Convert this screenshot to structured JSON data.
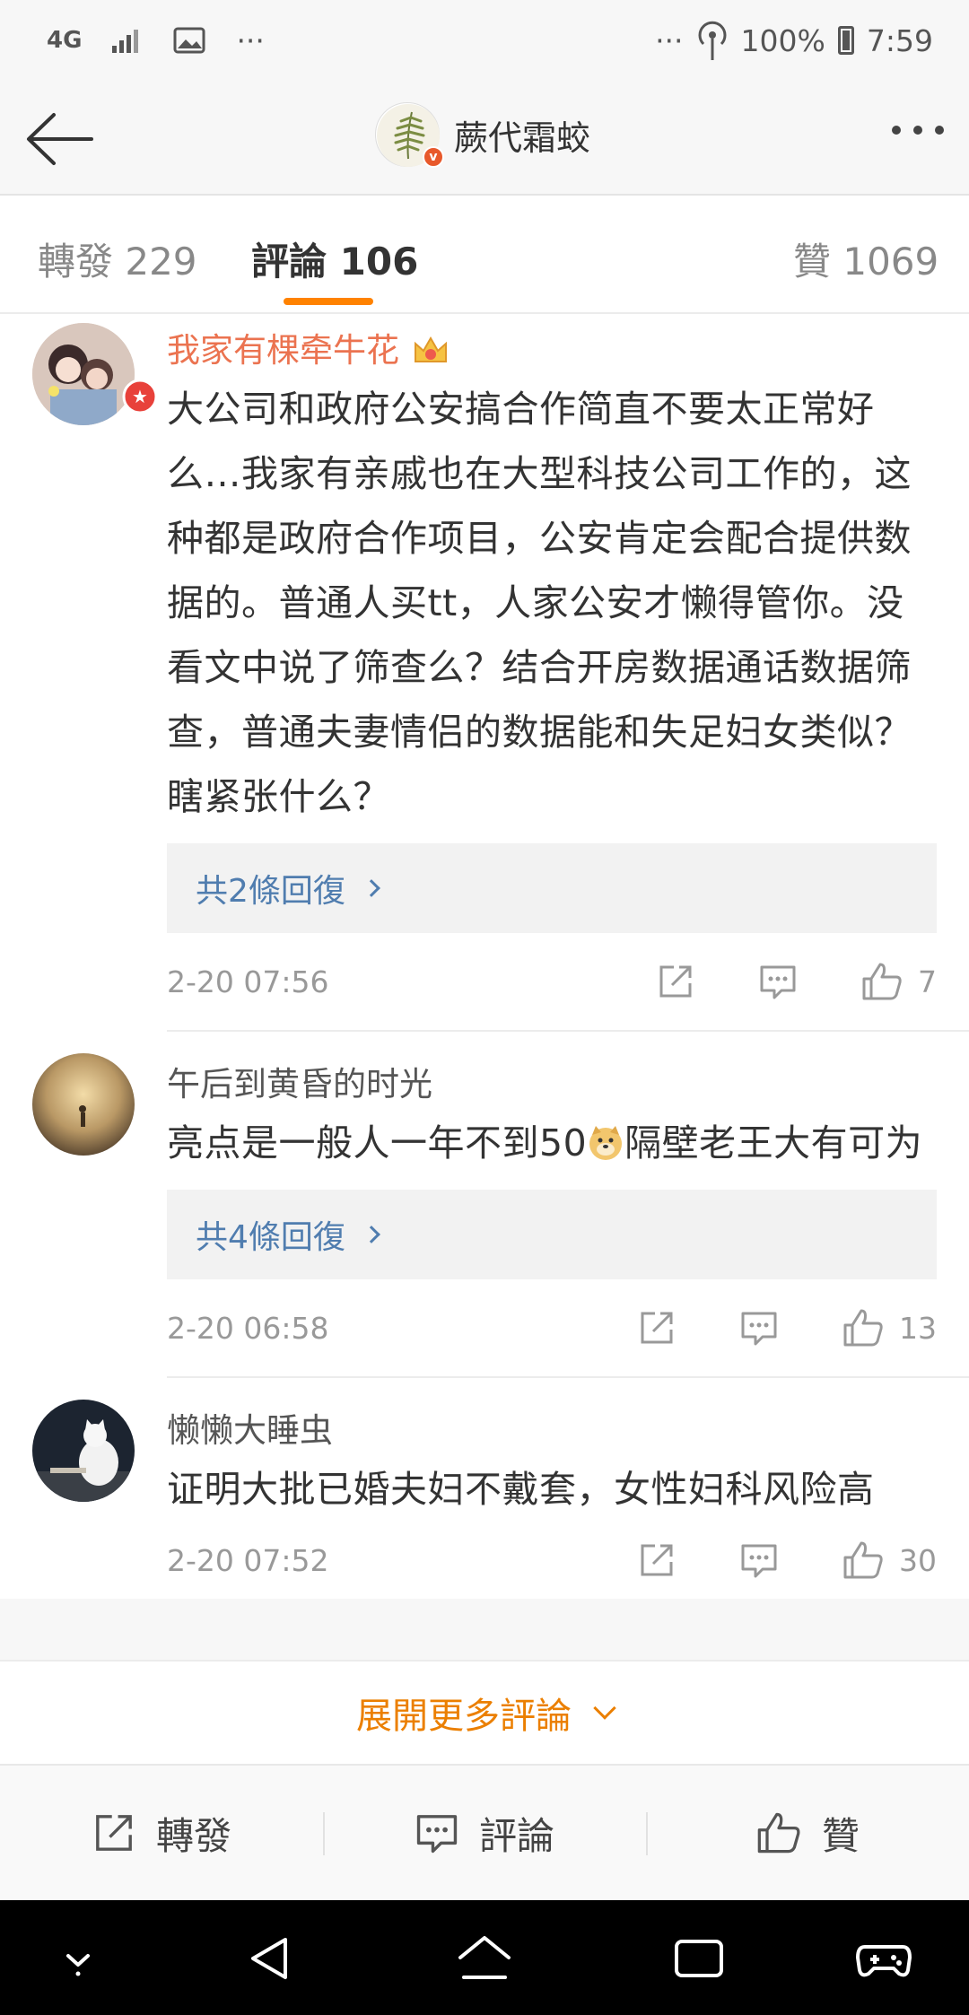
{
  "status_bar": {
    "network": "4G",
    "more": "···",
    "right_more": "···",
    "battery": "100%",
    "time": "7:59"
  },
  "header": {
    "title": "蕨代霜蛟",
    "back_icon": "back-arrow-icon",
    "more_icon": "more-dots-icon"
  },
  "tabs": {
    "repost": "轉發 229",
    "comments": "評論 106",
    "likes": "贊 1069"
  },
  "comments": [
    {
      "username": "我家有棵牵牛花",
      "content": "大公司和政府公安搞合作简直不要太正常好么…我家有亲戚也在大型科技公司工作的，这种都是政府合作项目，公安肯定会配合提供数据的。普通人买tt，人家公安才懒得管你。没看文中说了筛查么？结合开房数据通话数据筛查，普通夫妻情侣的数据能和失足妇女类似？瞎紧张什么？",
      "replies": "共2條回復",
      "time": "2-20 07:56",
      "likes": "7"
    },
    {
      "username": "午后到黄昏的时光",
      "content_before": "亮点是一般人一年不到50",
      "content_after": "隔壁老王大有可为",
      "emoji": "doge-emoji",
      "replies": "共4條回復",
      "time": "2-20 06:58",
      "likes": "13"
    },
    {
      "username": "懒懒大睡虫",
      "content": "证明大批已婚夫妇不戴套，女性妇科风险高",
      "time": "2-20 07:52",
      "likes": "30"
    }
  ],
  "expand": "展開更多評論",
  "bottom_bar": {
    "repost": "轉發",
    "comment": "評論",
    "like": "贊"
  },
  "colors": {
    "accent": "#ff8200",
    "vip_name": "#eb7350",
    "link": "#507daf"
  }
}
